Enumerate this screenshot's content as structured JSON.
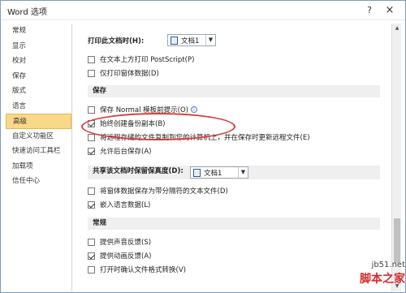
{
  "window": {
    "title": "Word 选项",
    "help": "?",
    "close": "×"
  },
  "sidebar": {
    "items": [
      "常规",
      "显示",
      "校对",
      "保存",
      "版式",
      "语言",
      "高级",
      "自定义功能区",
      "快速访问工具栏",
      "加载项",
      "信任中心"
    ],
    "selected": "高级"
  },
  "print": {
    "label": "打印此文档时(H):",
    "doc": "文档1",
    "opt1": "在文本上方打印 PostScript(P)",
    "opt2": "仅打印窗体数据(D)"
  },
  "save": {
    "header": "保存",
    "opt1": "保存 Normal 模板前提示(O)",
    "opt2": "始终创建备份副本(B)",
    "opt3": "将远程存储的文件复制到您的计算机上，并在保存时更新远程文件(E)",
    "opt4": "允许后台保存(A)"
  },
  "share": {
    "label": "共享该文档时保留保真度(D):",
    "doc": "文档1",
    "opt1": "将窗体数据保存为带分隔符的文本文件(D)",
    "opt2": "嵌入语言数据(L)"
  },
  "general": {
    "header": "常规",
    "opt1": "提供声音反馈(S)",
    "opt2": "提供动画反馈(A)",
    "opt3": "打开时确认文件格式转换(V)"
  },
  "watermark": {
    "line1": "jb51.net",
    "line2": "脚本之家"
  }
}
